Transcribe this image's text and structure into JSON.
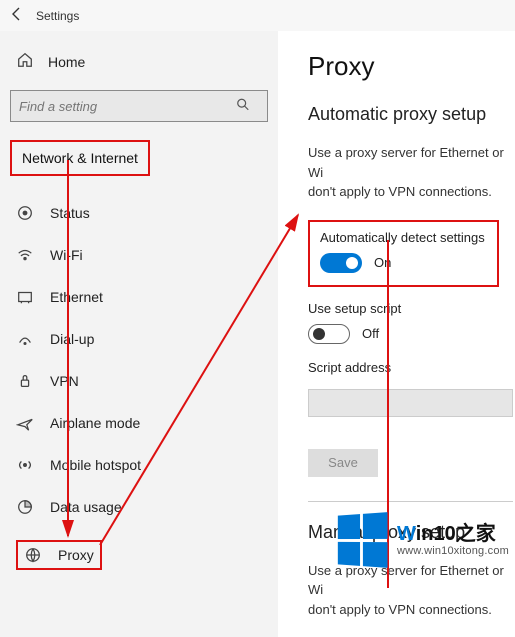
{
  "window": {
    "title": "Settings"
  },
  "sidebar": {
    "home": "Home",
    "search_placeholder": "Find a setting",
    "section": "Network & Internet",
    "items": [
      {
        "label": "Status"
      },
      {
        "label": "Wi-Fi"
      },
      {
        "label": "Ethernet"
      },
      {
        "label": "Dial-up"
      },
      {
        "label": "VPN"
      },
      {
        "label": "Airplane mode"
      },
      {
        "label": "Mobile hotspot"
      },
      {
        "label": "Data usage"
      },
      {
        "label": "Proxy"
      }
    ]
  },
  "main": {
    "title": "Proxy",
    "auto": {
      "heading": "Automatic proxy setup",
      "desc_line1": "Use a proxy server for Ethernet or Wi",
      "desc_line2": "don't apply to VPN connections.",
      "detect_label": "Automatically detect settings",
      "detect_state": "On",
      "script_label": "Use setup script",
      "script_state": "Off",
      "script_addr_label": "Script address",
      "save": "Save"
    },
    "manual": {
      "heading": "Manual proxy setup",
      "desc_line1": "Use a proxy server for Ethernet or Wi",
      "desc_line2": "don't apply to VPN connections."
    }
  },
  "watermark": {
    "brand_left": "W",
    "brand_mid": "in10",
    "brand_tag": "之家",
    "url": "www.win10xitong.com"
  },
  "colors": {
    "accent": "#0078d4",
    "annotation": "#d11"
  }
}
